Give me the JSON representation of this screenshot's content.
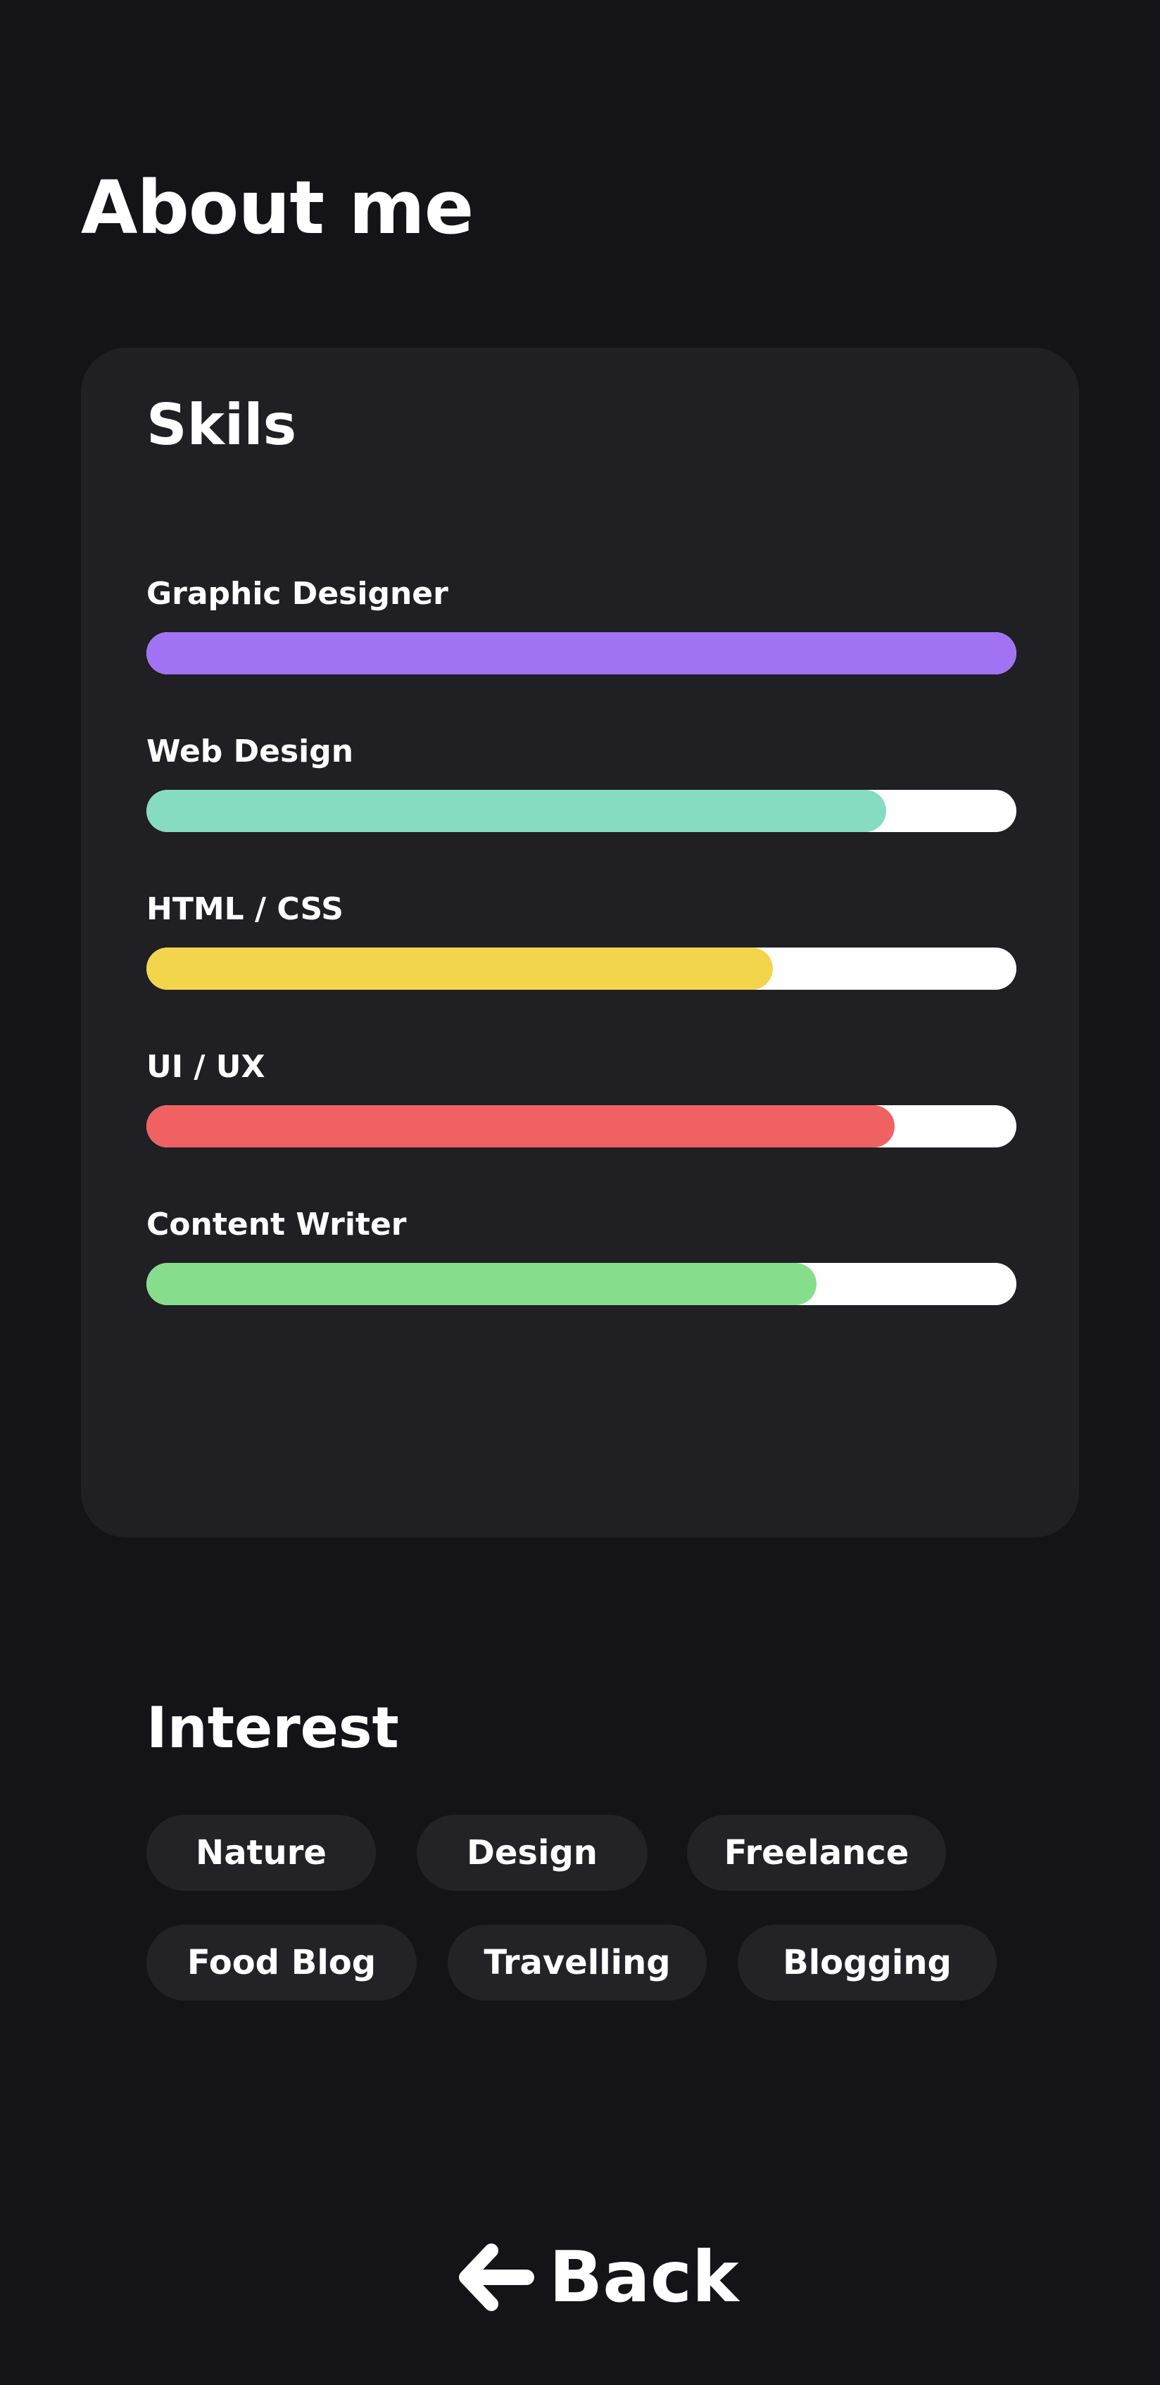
{
  "page": {
    "title": "About me"
  },
  "skills": {
    "title": "Skils",
    "items": [
      {
        "label": "Graphic Designer",
        "level": 1.0,
        "color": "#a172f3"
      },
      {
        "label": "Web Design",
        "level": 0.85,
        "color": "#86dcc3"
      },
      {
        "label": "HTML / CSS",
        "level": 0.72,
        "color": "#f3d54b"
      },
      {
        "label": "UI / UX",
        "level": 0.86,
        "color": "#f06161"
      },
      {
        "label": "Content Writer",
        "level": 0.77,
        "color": "#86de8c"
      }
    ],
    "track_color": "#ffffff"
  },
  "interest": {
    "title": "Interest",
    "tags": [
      "Nature",
      "Design",
      "Freelance",
      "Food Blog",
      "Travelling",
      "Blogging"
    ]
  },
  "back": {
    "label": "Back",
    "icon": "arrow-left-icon"
  }
}
